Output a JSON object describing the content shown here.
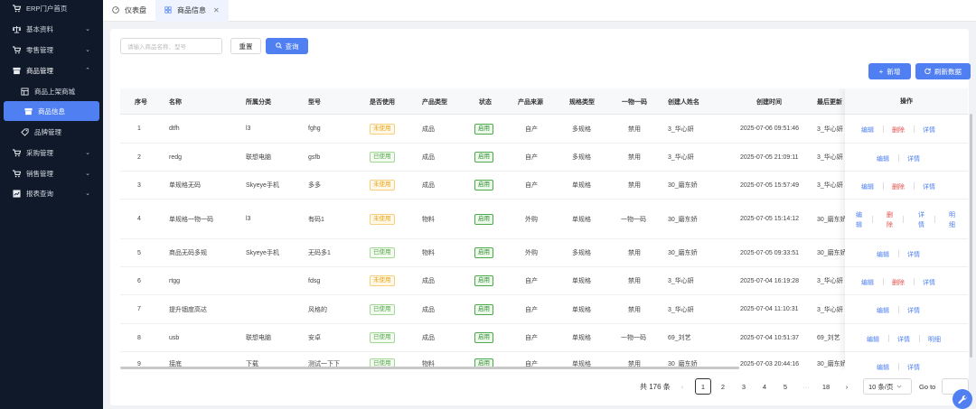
{
  "sidebar": {
    "items": [
      {
        "label": "ERP门户首页",
        "icon": "cart-icon",
        "arrow": ""
      },
      {
        "label": "基本资料",
        "icon": "scale-icon",
        "arrow": "⌄"
      },
      {
        "label": "零售管理",
        "icon": "cart-icon",
        "arrow": "⌄"
      },
      {
        "label": "商品管理",
        "icon": "box-icon",
        "arrow": "⌃"
      },
      {
        "label": "商品上架商城",
        "icon": "shop-icon",
        "arrow": ""
      },
      {
        "label": "商品信息",
        "icon": "box-icon",
        "arrow": ""
      },
      {
        "label": "品牌管理",
        "icon": "tag-icon",
        "arrow": ""
      },
      {
        "label": "采购管理",
        "icon": "cart-icon",
        "arrow": "⌄"
      },
      {
        "label": "销售管理",
        "icon": "cart-icon",
        "arrow": "⌄"
      },
      {
        "label": "报表查询",
        "icon": "report-icon",
        "arrow": "⌄"
      }
    ]
  },
  "tabs": [
    {
      "label": "仪表盘",
      "icon": "dashboard-icon"
    },
    {
      "label": "商品信息",
      "icon": "grid-icon",
      "close": "✕"
    }
  ],
  "toolbar": {
    "search_placeholder": "请输入商品名称、型号",
    "reset_label": "重置",
    "query_label": "查询",
    "add_label": "新增",
    "refresh_label": "刷新数据"
  },
  "table": {
    "headers": [
      "序号",
      "名称",
      "所属分类",
      "型号",
      "是否使用",
      "产品类型",
      "状态",
      "产品来源",
      "规格类型",
      "一物一码",
      "创建人姓名",
      "创建时间",
      "最后更新",
      "操作"
    ],
    "rows": [
      {
        "no": "1",
        "name": "dtfh",
        "category": "l3",
        "model": "fghg",
        "used": "未使用",
        "type": "成品",
        "status": "启用",
        "source": "自产",
        "spec": "多规格",
        "code": "禁用",
        "creator": "3_华心妍",
        "created": "2025-07-06 09:51:46",
        "updated": "3_华心妍",
        "ops": [
          "编辑",
          "删除",
          "详情"
        ]
      },
      {
        "no": "2",
        "name": "redg",
        "category": "联想电脑",
        "model": "gsfb",
        "used": "已使用",
        "type": "成品",
        "status": "启用",
        "source": "自产",
        "spec": "多规格",
        "code": "禁用",
        "creator": "3_华心妍",
        "created": "2025-07-05 21:09:11",
        "updated": "3_华心妍",
        "ops": [
          "编辑",
          "详情"
        ]
      },
      {
        "no": "3",
        "name": "单规格无码",
        "category": "Skyeye手机",
        "model": "多多",
        "used": "未使用",
        "type": "成品",
        "status": "启用",
        "source": "自产",
        "spec": "单规格",
        "code": "禁用",
        "creator": "30_磨东娇",
        "created": "2025-07-05 15:57:49",
        "updated": "3_华心妍",
        "ops": [
          "编辑",
          "删除",
          "详情"
        ]
      },
      {
        "no": "4",
        "name": "单规格一物一码",
        "category": "l3",
        "model": "有码1",
        "used": "未使用",
        "type": "物料",
        "status": "启用",
        "source": "外购",
        "spec": "单规格",
        "code": "一物一码",
        "creator": "30_磨东娇",
        "created": "2025-07-05 15:14:12",
        "updated": "30_磨东娇",
        "ops": [
          "编辑",
          "删除",
          "详情",
          "明细"
        ]
      },
      {
        "no": "5",
        "name": "商品无码多规",
        "category": "Skyeye手机",
        "model": "无码多1",
        "used": "已使用",
        "type": "物料",
        "status": "启用",
        "source": "外购",
        "spec": "多规格",
        "code": "禁用",
        "creator": "30_磨东娇",
        "created": "2025-07-05 09:33:51",
        "updated": "30_磨东娇",
        "ops": [
          "编辑",
          "详情"
        ]
      },
      {
        "no": "6",
        "name": "rtgg",
        "category": "",
        "model": "fdsg",
        "used": "未使用",
        "type": "成品",
        "status": "启用",
        "source": "自产",
        "spec": "单规格",
        "code": "禁用",
        "creator": "3_华心妍",
        "created": "2025-07-04 16:19:28",
        "updated": "3_华心妍",
        "ops": [
          "编辑",
          "删除",
          "详情"
        ]
      },
      {
        "no": "7",
        "name": "提升锢度高达",
        "category": "",
        "model": "风格的",
        "used": "已使用",
        "type": "成品",
        "status": "启用",
        "source": "自产",
        "spec": "单规格",
        "code": "禁用",
        "creator": "3_华心妍",
        "created": "2025-07-04 11:10:31",
        "updated": "3_华心妍",
        "ops": [
          "编辑",
          "详情"
        ]
      },
      {
        "no": "8",
        "name": "usb",
        "category": "联想电脑",
        "model": "安卓",
        "used": "已使用",
        "type": "成品",
        "status": "启用",
        "source": "自产",
        "spec": "单规格",
        "code": "一物一码",
        "creator": "69_刘艺",
        "created": "2025-07-04 10:51:37",
        "updated": "69_刘艺",
        "ops": [
          "编辑",
          "详情",
          "明细"
        ]
      },
      {
        "no": "9",
        "name": "接底",
        "category": "下载",
        "model": "测试一下下",
        "used": "已使用",
        "type": "物料",
        "status": "启用",
        "source": "自产",
        "spec": "单规格",
        "code": "禁用",
        "creator": "30_磨东娇",
        "created": "2025-07-03 20:44:16",
        "updated": "30_磨东娇",
        "ops": [
          "编辑",
          "详情"
        ]
      }
    ]
  },
  "pagination": {
    "total": "共 176 条",
    "prev": "‹",
    "pages": [
      "1",
      "2",
      "3",
      "4",
      "5",
      "···",
      "18"
    ],
    "next": "›",
    "page_size": "10 条/页",
    "goto_label": "Go to"
  },
  "colors": {
    "accent": "#4f7ff0",
    "sidebar": "#0f1929",
    "danger": "#e0504a",
    "warning": "#e7a419",
    "success": "#52a447"
  }
}
